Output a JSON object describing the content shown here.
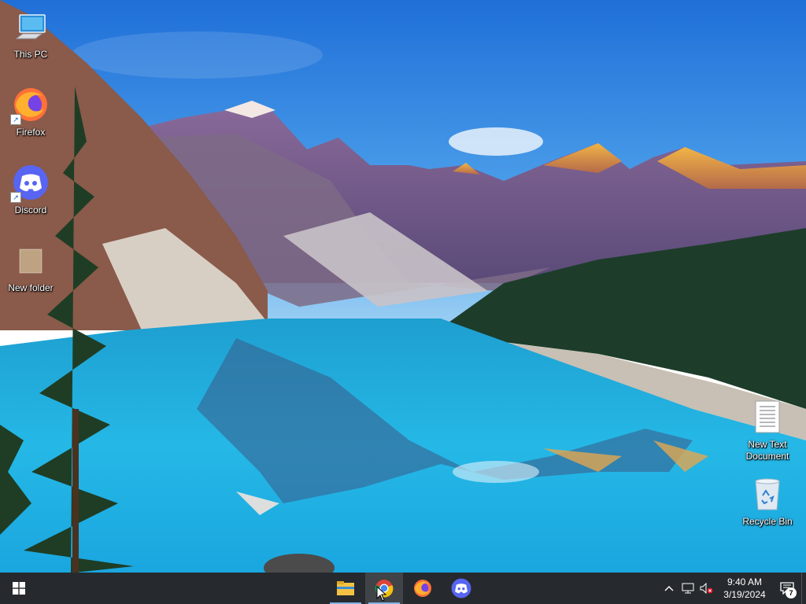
{
  "desktop": {
    "icons": [
      {
        "label": "This PC",
        "icon": "this-pc-icon"
      },
      {
        "label": "Firefox",
        "icon": "firefox-icon"
      },
      {
        "label": "Discord",
        "icon": "discord-icon"
      },
      {
        "label": "New folder",
        "icon": "folder-icon"
      },
      {
        "label": "New Text Document",
        "icon": "text-document-icon"
      },
      {
        "label": "Recycle Bin",
        "icon": "recycle-bin-icon"
      }
    ]
  },
  "taskbar": {
    "apps": [
      {
        "name": "File Explorer",
        "icon": "file-explorer-icon",
        "active": true
      },
      {
        "name": "Google Chrome",
        "icon": "chrome-icon",
        "active": true
      },
      {
        "name": "Firefox",
        "icon": "firefox-icon",
        "active": false
      },
      {
        "name": "Discord",
        "icon": "discord-icon",
        "active": false
      }
    ],
    "tray": {
      "time": "9:40 AM",
      "date": "3/19/2024",
      "notification_count": "7"
    }
  },
  "colors": {
    "taskbar": "#14181c",
    "accent": "#7fb4e8",
    "discord": "#5865f2",
    "firefox": "#ff7139"
  }
}
